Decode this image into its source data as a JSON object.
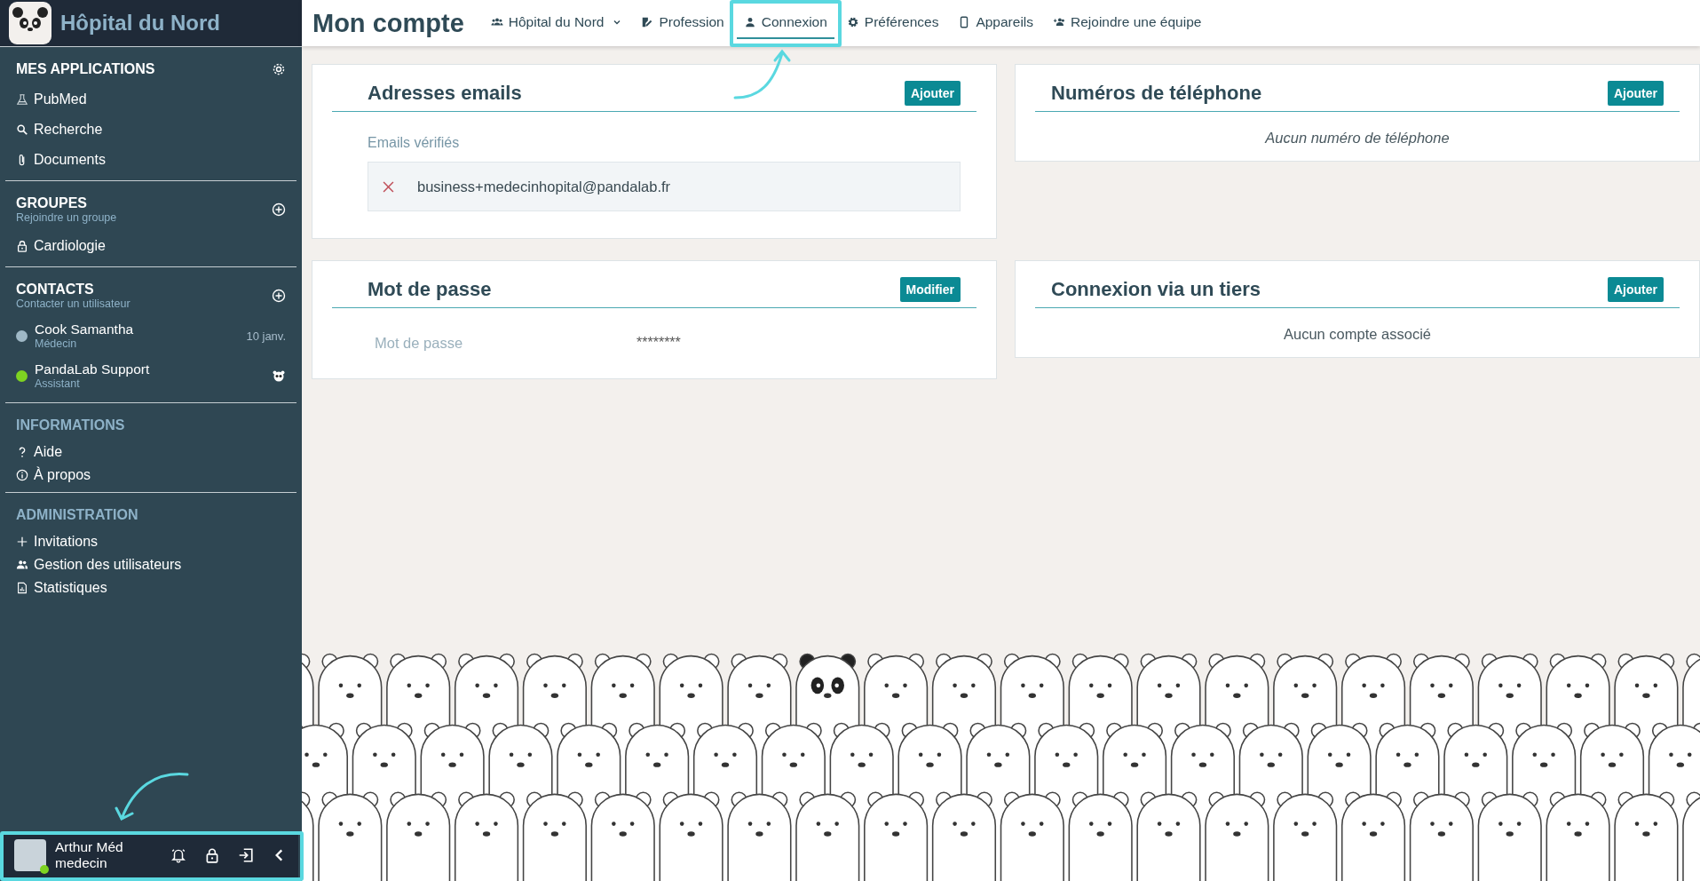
{
  "sidebar": {
    "brand": "Hôpital du Nord",
    "applications": {
      "title": "MES APPLICATIONS",
      "items": [
        {
          "label": "PubMed"
        },
        {
          "label": "Recherche"
        },
        {
          "label": "Documents"
        }
      ]
    },
    "groups": {
      "title": "GROUPES",
      "subtitle": "Rejoindre un groupe",
      "items": [
        {
          "label": "Cardiologie"
        }
      ]
    },
    "contacts": {
      "title": "CONTACTS",
      "subtitle": "Contacter un utilisateur",
      "items": [
        {
          "name": "Cook Samantha",
          "role": "Médecin",
          "color": "#9fb8c6",
          "meta": "10 janv."
        },
        {
          "name": "PandaLab Support",
          "role": "Assistant",
          "color": "#7ed321"
        }
      ]
    },
    "informations": {
      "title": "INFORMATIONS",
      "items": [
        {
          "label": "Aide"
        },
        {
          "label": "À propos"
        }
      ]
    },
    "administration": {
      "title": "ADMINISTRATION",
      "items": [
        {
          "label": "Invitations"
        },
        {
          "label": "Gestion des utilisateurs"
        },
        {
          "label": "Statistiques"
        }
      ]
    },
    "user": {
      "name": "Arthur Méd",
      "role": "medecin"
    }
  },
  "page": {
    "title": "Mon compte",
    "tabs": [
      {
        "label": "Hôpital du Nord",
        "dropdown": true,
        "selected": false
      },
      {
        "label": "Profession",
        "dropdown": false,
        "selected": false
      },
      {
        "label": "Connexion",
        "dropdown": false,
        "selected": true
      },
      {
        "label": "Préférences",
        "dropdown": false,
        "selected": false
      },
      {
        "label": "Appareils",
        "dropdown": false,
        "selected": false
      },
      {
        "label": "Rejoindre une équipe",
        "dropdown": false,
        "selected": false
      }
    ]
  },
  "columns": [
    {
      "cards": [
        {
          "kind": "emails",
          "title": "Adresses emails",
          "button": "Ajouter",
          "section_label": "Emails vérifiés",
          "emails": [
            "business+medecinhopital@pandalab.fr"
          ]
        },
        {
          "kind": "password",
          "title": "Mot de passe",
          "button": "Modifier",
          "label": "Mot de passe",
          "value": "********"
        }
      ]
    },
    {
      "cards": [
        {
          "kind": "empty",
          "title": "Numéros de téléphone",
          "button": "Ajouter",
          "empty_text": "Aucun numéro de téléphone",
          "italic": true
        },
        {
          "kind": "empty",
          "title": "Connexion via un tiers",
          "button": "Ajouter",
          "empty_text": "Aucun compte associé",
          "italic": false
        }
      ]
    }
  ]
}
